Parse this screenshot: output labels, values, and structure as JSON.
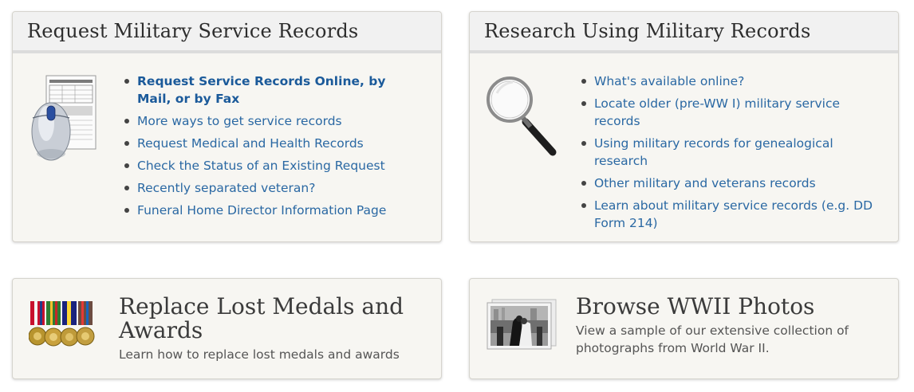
{
  "cards": {
    "request": {
      "title": "Request Military Service Records",
      "image_icon": "mouse-and-form-icon",
      "links": [
        "Request Service Records Online, by Mail, or by Fax",
        "More ways to get service records",
        "Request Medical and Health Records",
        "Check the Status of an Existing Request",
        "Recently separated veteran?",
        "Funeral Home Director Information Page"
      ]
    },
    "research": {
      "title": "Research Using Military Records",
      "image_icon": "magnifying-glass-icon",
      "links": [
        "What's available online?",
        "Locate older (pre-WW I) military service records",
        "Using military records for genealogical research",
        "Other military and veterans records",
        "Learn about military service records (e.g. DD Form 214)"
      ]
    },
    "medals": {
      "title": "Replace Lost Medals and Awards",
      "description": "Learn how to replace lost medals and awards",
      "image_icon": "medals-icon"
    },
    "photos": {
      "title": "Browse WWII Photos",
      "description": "View a sample of our extensive collection of photographs from World War II.",
      "image_icon": "wwii-photo-icon"
    }
  },
  "colors": {
    "link": "#2a68a3",
    "card_bg": "#f7f6f2",
    "header_bg": "#f1f1f1",
    "title": "#2d2d2d"
  }
}
